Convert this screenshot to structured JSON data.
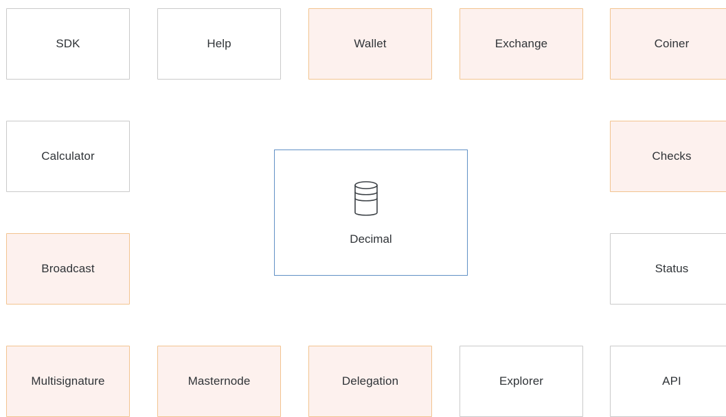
{
  "diagram": {
    "center": {
      "label": "Decimal",
      "icon": "database-icon",
      "border_color": "#5e8fc4"
    },
    "colors": {
      "highlight_border": "#f2c38e",
      "highlight_fill": "#fdf1ee",
      "plain_border": "#c9c9c9"
    },
    "nodes": {
      "sdk": {
        "label": "SDK",
        "highlighted": false
      },
      "help": {
        "label": "Help",
        "highlighted": false
      },
      "wallet": {
        "label": "Wallet",
        "highlighted": true
      },
      "exchange": {
        "label": "Exchange",
        "highlighted": true
      },
      "coiner": {
        "label": "Coiner",
        "highlighted": true
      },
      "calculator": {
        "label": "Calculator",
        "highlighted": false
      },
      "checks": {
        "label": "Checks",
        "highlighted": true
      },
      "broadcast": {
        "label": "Broadcast",
        "highlighted": true
      },
      "status": {
        "label": "Status",
        "highlighted": false
      },
      "multisignature": {
        "label": "Multisignature",
        "highlighted": true
      },
      "masternode": {
        "label": "Masternode",
        "highlighted": true
      },
      "delegation": {
        "label": "Delegation",
        "highlighted": true
      },
      "explorer": {
        "label": "Explorer",
        "highlighted": false
      },
      "api": {
        "label": "API",
        "highlighted": false
      }
    }
  }
}
